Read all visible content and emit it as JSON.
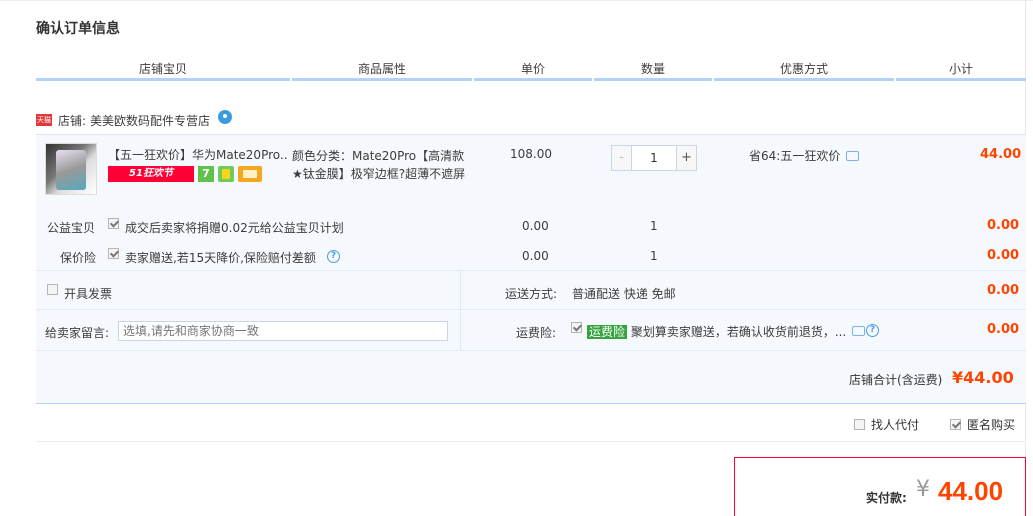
{
  "page": {
    "title": "确认订单信息"
  },
  "columns": [
    "店铺宝贝",
    "商品属性",
    "单价",
    "数量",
    "优惠方式",
    "小计"
  ],
  "shop": {
    "badge": "天猫",
    "name_prefix": "店铺:",
    "name": "美美欧数码配件专营店"
  },
  "item": {
    "title": "【五一狂欢价】华为Mate20Pro...",
    "promo_label": "51狂欢节",
    "promo_icon_text": "7",
    "sku": "颜色分类：Mate20Pro【高清款★钛金膜】极窄边框?超薄不遮屏",
    "unit_price": "108.00",
    "quantity": "1",
    "qty_minus": "-",
    "qty_plus": "+",
    "discount": "省64:五一狂欢价",
    "subtotal": "44.00"
  },
  "services": [
    {
      "label": "公益宝贝",
      "checked": true,
      "text": "成交后卖家将捐赠0.02元给公益宝贝计划",
      "price": "0.00",
      "qty": "1",
      "subtotal": "0.00"
    },
    {
      "label": "保价险",
      "checked": true,
      "text": "卖家赠送,若15天降价,保险赔付差额",
      "help": "?",
      "price": "0.00",
      "qty": "1",
      "subtotal": "0.00"
    }
  ],
  "invoice": {
    "label": "开具发票",
    "checked": false
  },
  "shipping": {
    "label": "运送方式:",
    "value": "普通配送 快递 免邮",
    "amount": "0.00"
  },
  "message": {
    "label": "给卖家留言:",
    "placeholder": "选填,请先和商家协商一致"
  },
  "freight_insurance": {
    "label": "运费险:",
    "checked": true,
    "tag": "运费险",
    "text": "聚划算卖家赠送，若确认收货前退货，...",
    "help": "?",
    "amount": "0.00"
  },
  "store_total": {
    "label": "店铺合计(含运费)",
    "value": "¥44.00"
  },
  "options": {
    "proxy_pay": {
      "label": "找人代付",
      "checked": false
    },
    "anonymous": {
      "label": "匿名购买",
      "checked": true
    }
  },
  "payment": {
    "label": "实付款:",
    "currency": "¥",
    "amount": "44.00"
  },
  "colors": {
    "accent_red": "#ff4400",
    "header_bar": "#b2d1ff",
    "block_bg": "#f5f8fc",
    "freight_tag": "#35a43f"
  }
}
